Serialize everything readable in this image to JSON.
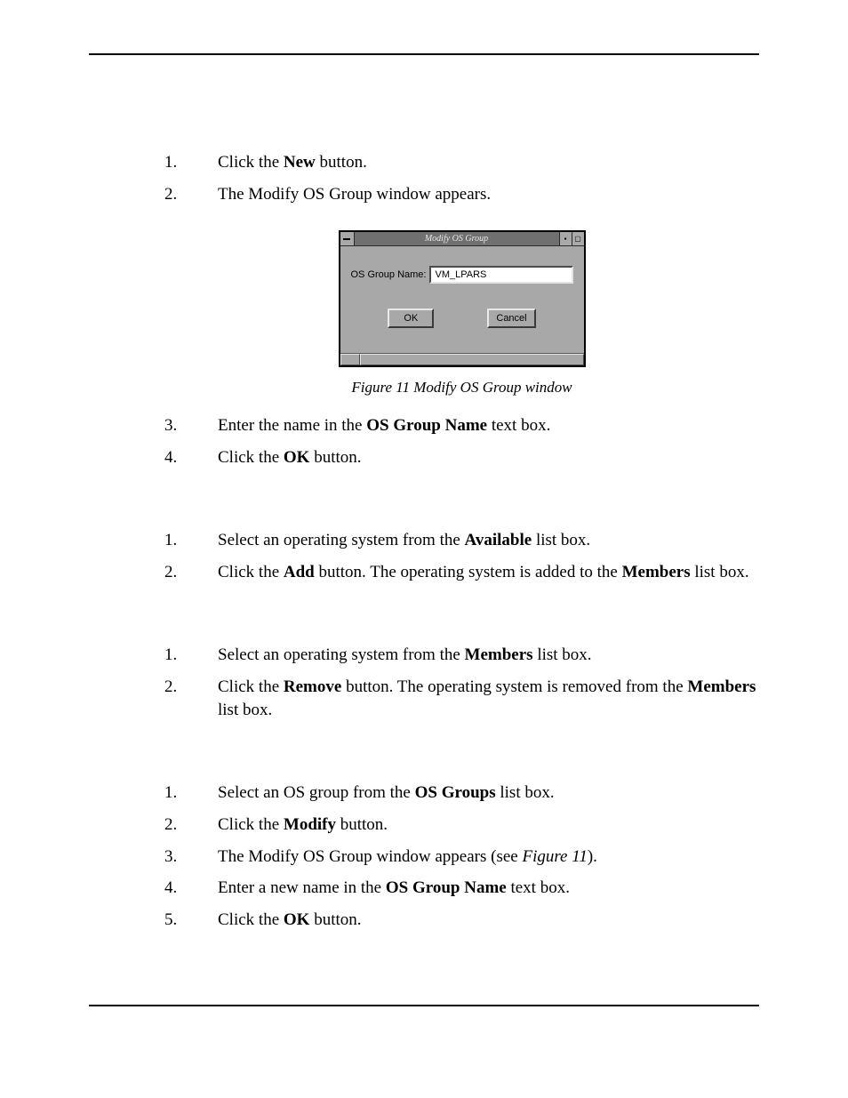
{
  "section_a": {
    "items": [
      {
        "num": "1.",
        "parts": [
          {
            "t": "Click the "
          },
          {
            "t": "New",
            "b": true
          },
          {
            "t": " button."
          }
        ]
      },
      {
        "num": "2.",
        "parts": [
          {
            "t": "The Modify OS Group window appears."
          }
        ]
      }
    ]
  },
  "dialog": {
    "title": "Modify OS Group",
    "field_label": "OS Group Name:",
    "field_value": "VM_LPARS",
    "ok_label": "OK",
    "cancel_label": "Cancel"
  },
  "figure_caption": "Figure 11 Modify OS Group window",
  "section_b": {
    "items": [
      {
        "num": "3.",
        "parts": [
          {
            "t": "Enter the name in the "
          },
          {
            "t": "OS Group Name",
            "b": true
          },
          {
            "t": " text box."
          }
        ]
      },
      {
        "num": "4.",
        "parts": [
          {
            "t": "Click the "
          },
          {
            "t": "OK",
            "b": true
          },
          {
            "t": " button."
          }
        ]
      }
    ]
  },
  "section_c": {
    "items": [
      {
        "num": "1.",
        "parts": [
          {
            "t": "Select an operating system from the "
          },
          {
            "t": "Available",
            "b": true
          },
          {
            "t": " list box."
          }
        ]
      },
      {
        "num": "2.",
        "parts": [
          {
            "t": "Click the "
          },
          {
            "t": "Add",
            "b": true
          },
          {
            "t": " button. The operating system is added to the "
          },
          {
            "t": "Members",
            "b": true
          },
          {
            "t": " list box."
          }
        ]
      }
    ]
  },
  "section_d": {
    "items": [
      {
        "num": "1.",
        "parts": [
          {
            "t": "Select an operating system from the "
          },
          {
            "t": "Members",
            "b": true
          },
          {
            "t": " list box."
          }
        ]
      },
      {
        "num": "2.",
        "parts": [
          {
            "t": "Click the "
          },
          {
            "t": "Remove",
            "b": true
          },
          {
            "t": " button. The operating system is removed from the "
          },
          {
            "t": "Members",
            "b": true
          },
          {
            "t": " list box."
          }
        ]
      }
    ]
  },
  "section_e": {
    "items": [
      {
        "num": "1.",
        "parts": [
          {
            "t": "Select an OS group from the "
          },
          {
            "t": "OS Groups",
            "b": true
          },
          {
            "t": " list box."
          }
        ]
      },
      {
        "num": "2.",
        "parts": [
          {
            "t": "Click the "
          },
          {
            "t": "Modify",
            "b": true
          },
          {
            "t": " button."
          }
        ]
      },
      {
        "num": "3.",
        "parts": [
          {
            "t": "The Modify OS Group window appears (see "
          },
          {
            "t": "Figure 11",
            "i": true
          },
          {
            "t": ")."
          }
        ]
      },
      {
        "num": "4.",
        "parts": [
          {
            "t": "Enter a new name in the "
          },
          {
            "t": "OS Group Name",
            "b": true
          },
          {
            "t": " text box."
          }
        ]
      },
      {
        "num": "5.",
        "parts": [
          {
            "t": "Click the "
          },
          {
            "t": "OK",
            "b": true
          },
          {
            "t": " button."
          }
        ]
      }
    ]
  }
}
